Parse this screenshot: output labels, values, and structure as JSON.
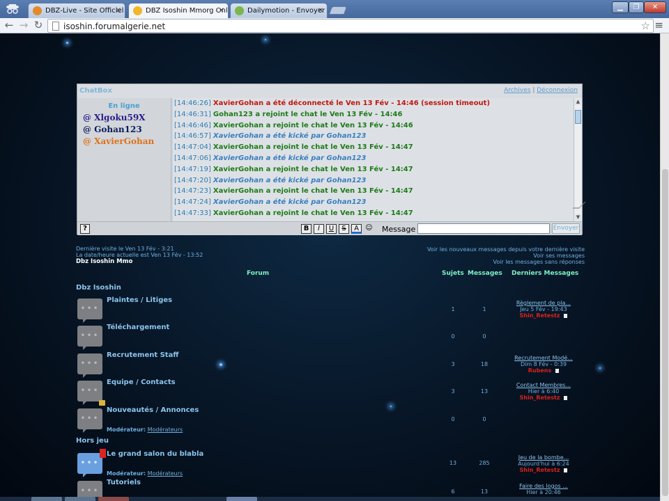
{
  "browser": {
    "tabs": [
      {
        "label": "DBZ-Live - Site Officiel du",
        "active": false,
        "favicon": "#e28a2c"
      },
      {
        "label": "DBZ Isoshin Mmorg Onlin",
        "active": true,
        "favicon": "#f0b82a"
      },
      {
        "label": "Dailymotion - Envoyer un",
        "active": false,
        "favicon": "#7ab64a"
      }
    ],
    "url": "isoshin.forumalgerie.net"
  },
  "chatbox": {
    "title": "ChatBox",
    "links": [
      "Archives",
      "Déconnexion"
    ],
    "link_separator": "|",
    "online_title": "En ligne",
    "users": [
      {
        "name": "@ Xlgoku59X",
        "color": "#2a1a8a"
      },
      {
        "name": "@ Gohan123",
        "color": "#0a1a5a"
      },
      {
        "name": "@ XavierGohan",
        "color": "#e0701a"
      }
    ],
    "messages": [
      {
        "time": "[14:46:26]",
        "text": "XavierGohan a été déconnecté le Ven 13 Fév - 14:46 (session timeout)",
        "kind": "red"
      },
      {
        "time": "[14:46:31]",
        "text": "Gohan123 a rejoint le chat le Ven 13 Fév - 14:46",
        "kind": "green"
      },
      {
        "time": "[14:46:46]",
        "text": "XavierGohan a rejoint le chat le Ven 13 Fév - 14:46",
        "kind": "green"
      },
      {
        "time": "[14:46:57]",
        "text": "XavierGohan a été kické par Gohan123",
        "kind": "blue"
      },
      {
        "time": "[14:47:04]",
        "text": "XavierGohan a rejoint le chat le Ven 13 Fév - 14:47",
        "kind": "green"
      },
      {
        "time": "[14:47:06]",
        "text": "XavierGohan a été kické par Gohan123",
        "kind": "blue"
      },
      {
        "time": "[14:47:19]",
        "text": "XavierGohan a rejoint le chat le Ven 13 Fév - 14:47",
        "kind": "green"
      },
      {
        "time": "[14:47:20]",
        "text": "XavierGohan a été kické par Gohan123",
        "kind": "blue"
      },
      {
        "time": "[14:47:23]",
        "text": "XavierGohan a rejoint le chat le Ven 13 Fév - 14:47",
        "kind": "green"
      },
      {
        "time": "[14:47:24]",
        "text": "XavierGohan a été kické par Gohan123",
        "kind": "blue"
      },
      {
        "time": "[14:47:33]",
        "text": "XavierGohan a rejoint le chat le Ven 13 Fév - 14:47",
        "kind": "green"
      }
    ],
    "help": "?",
    "format_buttons": [
      "B",
      "I",
      "U",
      "S",
      "A",
      "☺"
    ],
    "message_label": "Message :",
    "message_value": "",
    "send_label": "Envoyer"
  },
  "forum": {
    "last_visit": "Dernière visite le Ven 13 Fév - 3:21",
    "current_time": "La date/heure actuelle est Ven 13 Fév - 13:52",
    "site_name": "Dbz Isoshin Mmo",
    "links": [
      "Voir les nouveaux messages depuis votre dernière visite",
      "Voir ses messages",
      "Voir les messages sans réponses"
    ],
    "columns": {
      "forum": "Forum",
      "topics": "Sujets",
      "messages": "Messages",
      "last": "Derniers Messages"
    },
    "categories": [
      "Dbz Isoshin",
      "Hors jeu"
    ],
    "forums": [
      {
        "name": "Plaintes / Litiges",
        "topics": "1",
        "messages": "1",
        "last_title": "Règlement de pla...",
        "last_date": "Jeu 5 Fév - 19:43",
        "last_user": "Shin_Retestz"
      },
      {
        "name": "Téléchargement",
        "topics": "0",
        "messages": "0"
      },
      {
        "name": "Recrutement Staff",
        "topics": "3",
        "messages": "18",
        "last_title": "Recrutement Modé...",
        "last_date": "Dim 8 Fév - 0:39",
        "last_user": "Rubens"
      },
      {
        "name": "Equipe / Contacts",
        "topics": "3",
        "messages": "13",
        "last_title": "Contact Membres...",
        "last_date": "Hier à 6:40",
        "last_user": "Shin_Retestz"
      },
      {
        "name": "Nouveautés / Annonces",
        "topics": "0",
        "messages": "0",
        "mod_label": "Modérateur:",
        "mod_value": "Modérateurs"
      },
      {
        "name": "Le grand salon du blabla",
        "topics": "13",
        "messages": "285",
        "last_title": "Jeu de la bombe...",
        "last_date": "Aujourd'hui à 6:24",
        "last_user": "Shin_Retestz",
        "mod_label": "Modérateur:",
        "mod_value": "Modérateurs"
      },
      {
        "name": "Tutoriels",
        "topics": "6",
        "messages": "13",
        "last_title": "Faire des logos ...",
        "last_date": "Hier à 20:46"
      }
    ]
  }
}
